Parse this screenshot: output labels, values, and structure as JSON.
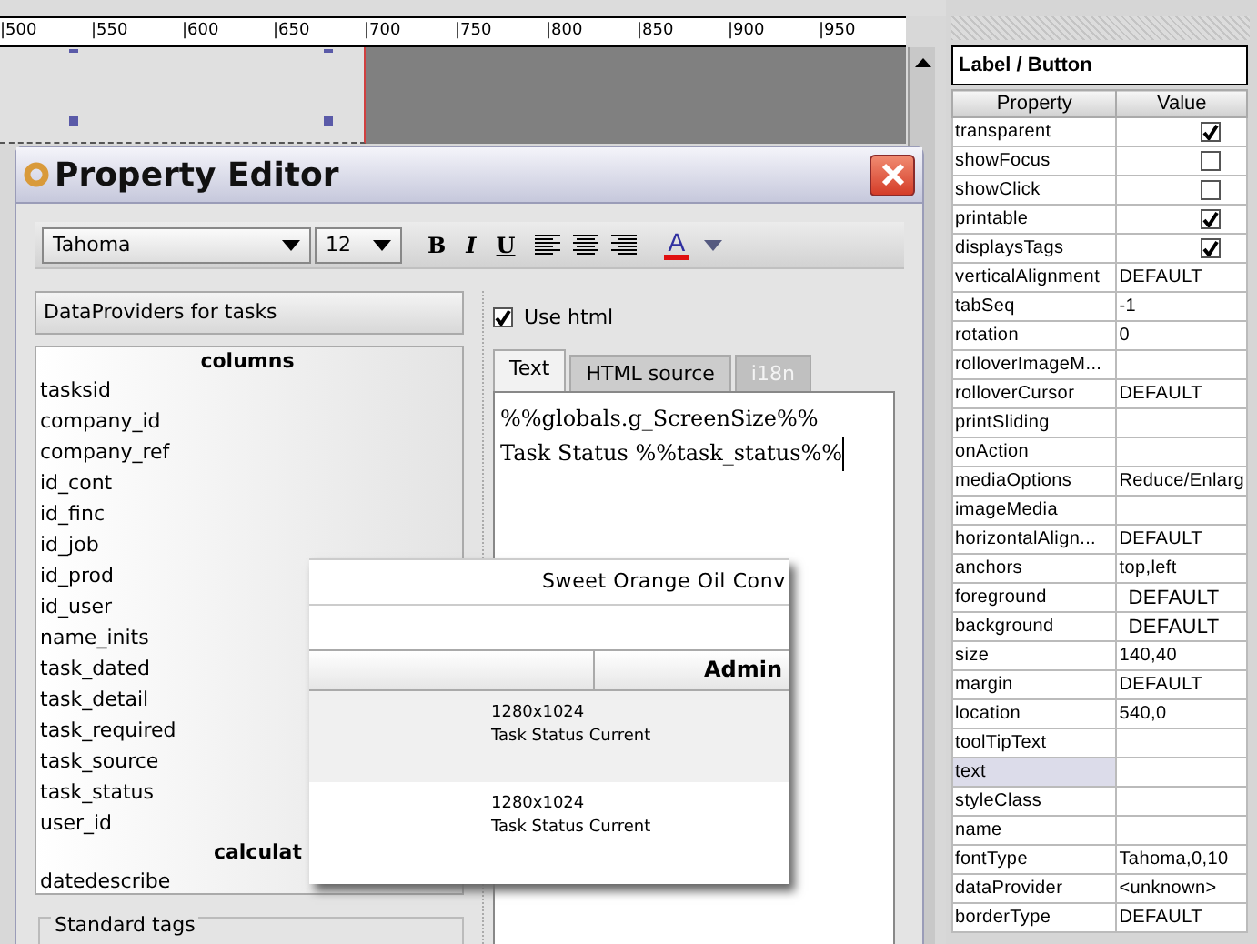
{
  "ruler": {
    "ticks": [
      "|500",
      "|550",
      "|600",
      "|650",
      "|700",
      "|750",
      "|800",
      "|850",
      "|900",
      "|950"
    ]
  },
  "editor": {
    "title": "Property Editor",
    "toolbar": {
      "font": "Tahoma",
      "size": "12",
      "styles": [
        "B",
        "I",
        "U"
      ],
      "color_letter": "A"
    },
    "dataproviders": {
      "title": "DataProviders for tasks",
      "groups": [
        {
          "heading": "columns",
          "items": [
            "tasksid",
            "company_id",
            "company_ref",
            "id_cont",
            "id_finc",
            "id_job",
            "id_prod",
            "id_user",
            "name_inits",
            "task_dated",
            "task_detail",
            "task_required",
            "task_source",
            "task_status",
            "user_id"
          ]
        },
        {
          "heading": "calculat",
          "items": [
            "datedescribe"
          ]
        }
      ]
    },
    "standard_tags": {
      "title": "Standard tags"
    },
    "use_html": {
      "label": "Use html",
      "checked": true
    },
    "tabs": [
      {
        "label": "Text",
        "selected": true,
        "disabled": false
      },
      {
        "label": "HTML source",
        "selected": false,
        "disabled": false
      },
      {
        "label": "i18n",
        "selected": false,
        "disabled": true
      }
    ],
    "text_lines": [
      "%%globals.g_ScreenSize%%",
      "Task Status %%task_status%%"
    ]
  },
  "popup": {
    "title": "Sweet Orange Oil Conv",
    "column_2": "Admin",
    "rows": [
      {
        "lines": [
          "1280x1024",
          "Task Status Current"
        ]
      },
      {
        "lines": [
          "1280x1024",
          "Task Status Current"
        ]
      }
    ]
  },
  "inspector": {
    "title": "Label / Button",
    "columns": [
      "Property",
      "Value"
    ],
    "rows": [
      {
        "name": "transparent",
        "kind": "check",
        "checked": true,
        "selected": false
      },
      {
        "name": "showFocus",
        "kind": "check",
        "checked": false,
        "selected": false
      },
      {
        "name": "showClick",
        "kind": "check",
        "checked": false,
        "selected": false
      },
      {
        "name": "printable",
        "kind": "check",
        "checked": true,
        "selected": false
      },
      {
        "name": "displaysTags",
        "kind": "check",
        "checked": true,
        "selected": false
      },
      {
        "name": "verticalAlignment",
        "kind": "text",
        "value": "DEFAULT",
        "selected": false
      },
      {
        "name": "tabSeq",
        "kind": "text",
        "value": "-1",
        "selected": false
      },
      {
        "name": "rotation",
        "kind": "text",
        "value": "0",
        "selected": false
      },
      {
        "name": "rolloverImageM...",
        "kind": "text",
        "selected": false
      },
      {
        "name": "rolloverCursor",
        "kind": "text",
        "value": "DEFAULT",
        "selected": false
      },
      {
        "name": "printSliding",
        "kind": "text",
        "selected": false
      },
      {
        "name": "onAction",
        "kind": "text",
        "selected": false
      },
      {
        "name": "mediaOptions",
        "kind": "text",
        "value": "Reduce/Enlarg",
        "selected": false
      },
      {
        "name": "imageMedia",
        "kind": "text",
        "selected": false
      },
      {
        "name": "horizontalAlign...",
        "kind": "text",
        "value": "DEFAULT",
        "selected": false
      },
      {
        "name": "anchors",
        "kind": "text",
        "value": "top,left",
        "selected": false
      },
      {
        "name": "foreground",
        "kind": "color",
        "value": "DEFAULT",
        "selected": false
      },
      {
        "name": "background",
        "kind": "color",
        "value": "DEFAULT",
        "selected": false
      },
      {
        "name": "size",
        "kind": "text",
        "value": "140,40",
        "selected": false
      },
      {
        "name": "margin",
        "kind": "text",
        "value": "DEFAULT",
        "selected": false
      },
      {
        "name": "location",
        "kind": "text",
        "value": "540,0",
        "selected": false
      },
      {
        "name": "toolTipText",
        "kind": "text",
        "selected": false
      },
      {
        "name": "text",
        "kind": "text",
        "selected": true
      },
      {
        "name": "styleClass",
        "kind": "text",
        "selected": false
      },
      {
        "name": "name",
        "kind": "text",
        "selected": false
      },
      {
        "name": "fontType",
        "kind": "text",
        "value": "Tahoma,0,10",
        "selected": false
      },
      {
        "name": "dataProvider",
        "kind": "text",
        "value": "<unknown>",
        "selected": false
      },
      {
        "name": "borderType",
        "kind": "text",
        "value": "DEFAULT",
        "selected": false
      }
    ]
  }
}
